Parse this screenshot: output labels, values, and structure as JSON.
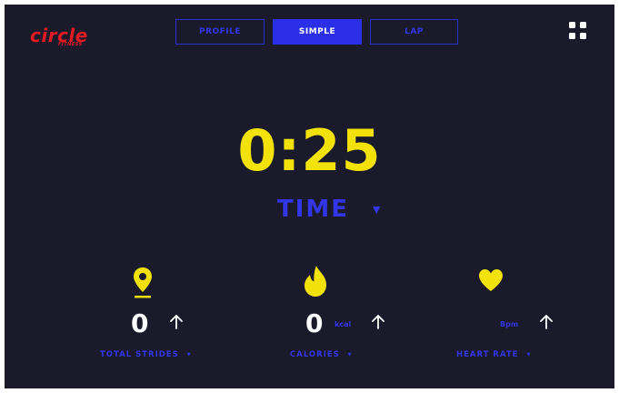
{
  "brand": {
    "logo": "circle",
    "sub": "FITNESS"
  },
  "tabs": [
    {
      "label": "PROFILE",
      "active": false
    },
    {
      "label": "SIMPLE",
      "active": true
    },
    {
      "label": "LAP",
      "active": false
    }
  ],
  "main": {
    "value": "0:25",
    "metric_label": "TIME",
    "metric_dropdown_icon": "caret-down-icon"
  },
  "stats": [
    {
      "icon": "map-pin-icon",
      "value": "0",
      "unit": "",
      "label": "TOTAL STRIDES",
      "trend_icon": "arrow-up-icon"
    },
    {
      "icon": "flame-icon",
      "value": "0",
      "unit": "kcal",
      "label": "CALORIES",
      "trend_icon": "arrow-up-icon"
    },
    {
      "icon": "heart-icon",
      "value": "",
      "unit": "Bpm",
      "label": "HEART RATE",
      "trend_icon": "arrow-up-icon"
    }
  ],
  "menu_icon": "grid-menu-icon",
  "colors": {
    "background": "#1b1a2b",
    "accent_blue": "#2b2fe8",
    "accent_yellow": "#f2e20a",
    "brand_red": "#e01b24",
    "text_white": "#ffffff"
  }
}
